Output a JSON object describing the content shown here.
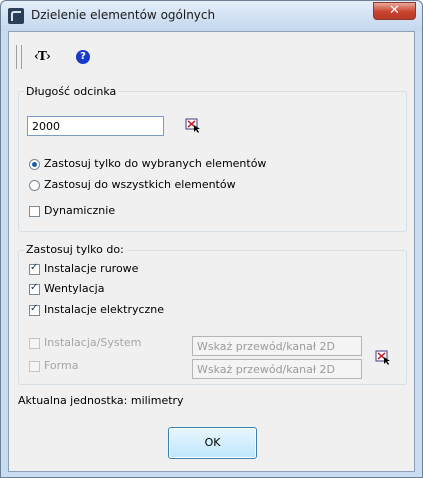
{
  "window": {
    "title": "Dzielenie elementów ogólnych",
    "close_label": "✕"
  },
  "toolbar": {
    "text_tool_label": "‹T›",
    "help_label": "?"
  },
  "segment_length": {
    "group_label": "Długość odcinka",
    "value": "2000"
  },
  "apply_scope": {
    "options": [
      {
        "label": "Zastosuj tylko do wybranych elementów",
        "selected": true
      },
      {
        "label": "Zastosuj do wszystkich elementów",
        "selected": false
      }
    ],
    "dynamic_label": "Dynamicznie",
    "dynamic_checked": false
  },
  "apply_only_to": {
    "group_label": "Zastosuj tylko do:",
    "items": [
      {
        "label": "Instalacje rurowe",
        "checked": true,
        "enabled": true
      },
      {
        "label": "Wentylacja",
        "checked": true,
        "enabled": true
      },
      {
        "label": "Instalacje elektryczne",
        "checked": true,
        "enabled": true
      },
      {
        "label": "Instalacja/System",
        "checked": false,
        "enabled": false
      },
      {
        "label": "Forma",
        "checked": false,
        "enabled": false
      }
    ],
    "system_placeholder": "Wskaż przewód/kanał 2D",
    "form_placeholder": "Wskaż przewód/kanał 2D"
  },
  "status": {
    "unit_text": "Aktualna jednostka: milimetry"
  },
  "actions": {
    "ok_label": "OK"
  }
}
